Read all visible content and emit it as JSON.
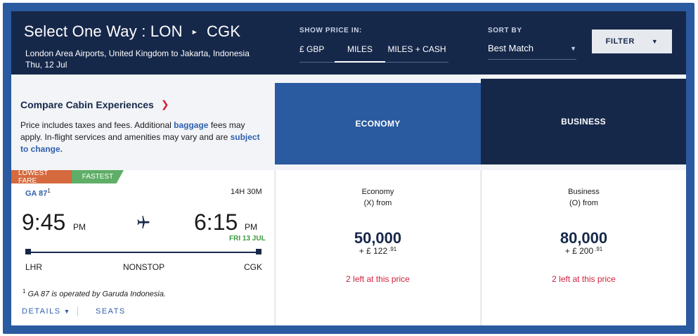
{
  "header": {
    "title_prefix": "Select One Way : LON",
    "route_arrow": "▸",
    "destination_code": "CGK",
    "route_description": "London Area Airports, United Kingdom to Jakarta, Indonesia",
    "date": "Thu, 12 Jul",
    "show_price_label": "SHOW PRICE IN:",
    "price_tabs": [
      {
        "label": "£ GBP",
        "active": false
      },
      {
        "label": "MILES",
        "active": true
      },
      {
        "label": "MILES + CASH",
        "active": false
      }
    ],
    "sort_label": "SORT BY",
    "sort_value": "Best Match",
    "filter_label": "FILTER"
  },
  "compare": {
    "title": "Compare Cabin Experiences",
    "text_1": "Price includes taxes and fees. Additional ",
    "link_baggage": "baggage",
    "text_2": " fees may apply. In-flight services and amenities may vary and are ",
    "link_subject": "subject to change."
  },
  "cabins": {
    "economy_label": "ECONOMY",
    "business_label": "BUSINESS"
  },
  "flight": {
    "badge_lowest": "LOWEST FARE",
    "badge_fastest": "FASTEST",
    "flight_number": "GA 87",
    "footnote_marker": "1",
    "duration": "14H 30M",
    "departure_time": "9:45",
    "departure_ampm": "PM",
    "arrival_time": "6:15",
    "arrival_ampm": "PM",
    "arrival_date": "FRI 13 JUL",
    "origin": "LHR",
    "stops": "NONSTOP",
    "destination": "CGK",
    "operated_by": " GA 87 is operated by Garuda Indonesia.",
    "details_label": "DETAILS",
    "seats_label": "SEATS"
  },
  "fares": {
    "economy": {
      "cabin": "Economy",
      "fare_class": "(X) from",
      "miles": "50,000",
      "cash": "+ £ 122",
      "cash_cents": ".91",
      "availability": "2 left at this price"
    },
    "business": {
      "cabin": "Business",
      "fare_class": "(O) from",
      "miles": "80,000",
      "cash": "+ £ 200",
      "cash_cents": ".91",
      "availability": "2 left at this price"
    }
  },
  "icons": {
    "route_arrow": "chevron-right-icon",
    "plane": "plane-icon",
    "dropdown": "chevron-down-icon"
  }
}
